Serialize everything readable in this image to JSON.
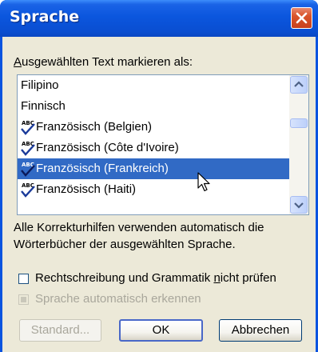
{
  "window": {
    "title": "Sprache"
  },
  "prompt": {
    "accesskey": "A",
    "rest": "usgewählten Text markieren als:"
  },
  "languages": {
    "items": [
      {
        "label": "Filipino",
        "spellcheck": false,
        "selected": false
      },
      {
        "label": "Finnisch",
        "spellcheck": false,
        "selected": false
      },
      {
        "label": "Französisch (Belgien)",
        "spellcheck": true,
        "selected": false
      },
      {
        "label": "Französisch (Côte d'Ivoire)",
        "spellcheck": true,
        "selected": false
      },
      {
        "label": "Französisch (Frankreich)",
        "spellcheck": true,
        "selected": true
      },
      {
        "label": "Französisch (Haiti)",
        "spellcheck": true,
        "selected": false
      }
    ]
  },
  "info": {
    "line1": "Alle Korrekturhilfen verwenden automatisch die",
    "line2": "Wörterbücher der ausgewählten Sprache."
  },
  "options": {
    "no_proofing": {
      "before": "Rechtschreibung und Grammatik ",
      "accesskey": "n",
      "after": "icht prüfen",
      "checked": false
    },
    "auto_detect": {
      "label": "Sprache automatisch erkennen",
      "enabled": false
    }
  },
  "buttons": {
    "default_label": "Standard...",
    "ok_label": "OK",
    "cancel_label": "Abbrechen"
  },
  "colors": {
    "titlebar": "#0a54e0",
    "selection": "#316ac5",
    "dialog_bg": "#ece9d8",
    "close_button": "#d9542a"
  }
}
